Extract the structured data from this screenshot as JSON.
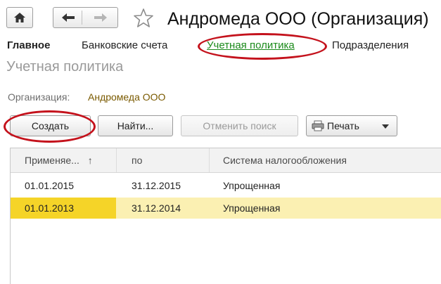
{
  "window": {
    "title": "Андромеда ООО (Организация)"
  },
  "tabs": [
    {
      "label": "Главное"
    },
    {
      "label": "Банковские счета"
    },
    {
      "label": "Учетная политика"
    },
    {
      "label": "Подразделения"
    }
  ],
  "section": {
    "title": "Учетная политика"
  },
  "organization": {
    "label": "Организация:",
    "value": "Андромеда ООО"
  },
  "toolbar": {
    "create_label": "Создать",
    "find_label": "Найти...",
    "cancel_search_label": "Отменить поиск",
    "print_label": "Печать"
  },
  "table": {
    "columns": [
      {
        "label": "Применяе...",
        "sort": "↑"
      },
      {
        "label": "по"
      },
      {
        "label": "Система налогообложения"
      }
    ],
    "rows": [
      {
        "from": "01.01.2015",
        "to": "31.12.2015",
        "system": "Упрощенная",
        "selected": false
      },
      {
        "from": "01.01.2013",
        "to": "31.12.2014",
        "system": "Упрощенная",
        "selected": true
      }
    ]
  },
  "colors": {
    "active_tab": "#1b8a1b",
    "highlight_ellipse": "#c4121c",
    "selected_row": "#fbf0b2",
    "current_cell": "#f5d428",
    "org_value": "#7a5a00"
  },
  "icons": [
    "home-icon",
    "back-arrow-icon",
    "forward-arrow-icon",
    "favorite-star-icon",
    "printer-icon",
    "dropdown-arrow-icon"
  ]
}
